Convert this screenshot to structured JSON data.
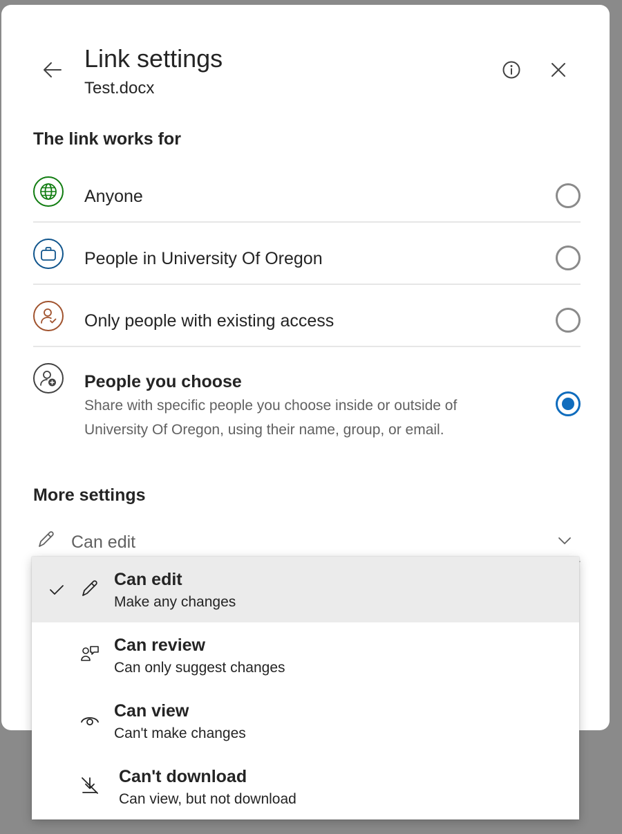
{
  "header": {
    "title": "Link settings",
    "subtitle": "Test.docx",
    "back_icon": "arrow-left-icon",
    "info_icon": "info-icon",
    "close_icon": "close-icon"
  },
  "link_works_for": {
    "heading": "The link works for",
    "options": [
      {
        "label": "Anyone",
        "icon": "globe-icon",
        "color": "#107c10",
        "checked": false
      },
      {
        "label": "People in University Of Oregon",
        "icon": "briefcase-icon",
        "color": "#0f548c",
        "checked": false
      },
      {
        "label": "Only people with existing access",
        "icon": "person-check-icon",
        "color": "#a0522d",
        "checked": false
      },
      {
        "label": "People you choose",
        "description": "Share with specific people you choose inside or outside of University Of Oregon, using their name, group, or email.",
        "icon": "person-add-icon",
        "color": "#424242",
        "checked": true
      }
    ]
  },
  "more_settings": {
    "heading": "More settings",
    "permission_value": "Can edit",
    "permission_menu": [
      {
        "title": "Can edit",
        "description": "Make any changes",
        "icon": "pencil-icon",
        "selected": true
      },
      {
        "title": "Can review",
        "description": "Can only suggest changes",
        "icon": "review-icon",
        "selected": false
      },
      {
        "title": "Can view",
        "description": "Can't make changes",
        "icon": "eye-icon",
        "selected": false
      },
      {
        "title": "Can't download",
        "description": "Can view, but not download",
        "icon": "no-download-icon",
        "selected": false
      }
    ]
  },
  "colors": {
    "accent": "#0f6cbd",
    "radio_unchecked": "#8a8a8a",
    "backdrop": "#8a8a8a"
  }
}
